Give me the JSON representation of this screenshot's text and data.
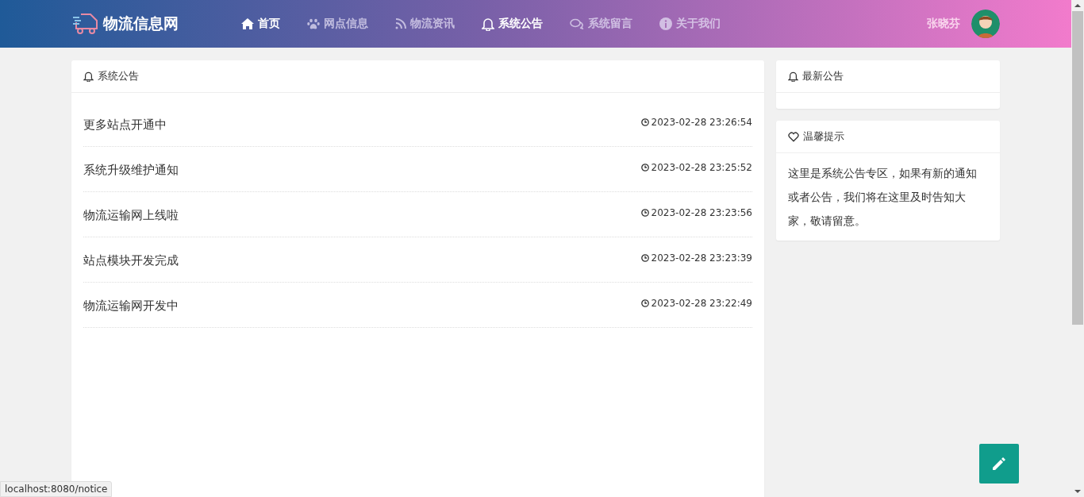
{
  "brand": {
    "name": "物流信息网"
  },
  "nav": [
    {
      "label": "首页",
      "kind": "home",
      "selected": true
    },
    {
      "label": "网点信息",
      "kind": "paw",
      "selected": false
    },
    {
      "label": "物流资讯",
      "kind": "rss",
      "selected": false
    },
    {
      "label": "系统公告",
      "kind": "bell",
      "selected": true
    },
    {
      "label": "系统留言",
      "kind": "comments",
      "selected": false
    },
    {
      "label": "关于我们",
      "kind": "info",
      "selected": false
    }
  ],
  "user": {
    "name": "张晓芬"
  },
  "notices": {
    "title": "系统公告",
    "items": [
      {
        "title": "更多站点开通中",
        "time": "2023-02-28 23:26:54"
      },
      {
        "title": "系统升级维护通知",
        "time": "2023-02-28 23:25:52"
      },
      {
        "title": "物流运输网上线啦",
        "time": "2023-02-28 23:23:56"
      },
      {
        "title": "站点模块开发完成",
        "time": "2023-02-28 23:23:39"
      },
      {
        "title": "物流运输网开发中",
        "time": "2023-02-28 23:22:49"
      }
    ]
  },
  "latest": {
    "title": "最新公告"
  },
  "tip": {
    "title": "温馨提示",
    "text": "这里是系统公告专区，如果有新的通知或者公告，我们将在这里及时告知大家，敬请留意。"
  },
  "status_bar": {
    "url": "localhost:8080/notice"
  }
}
